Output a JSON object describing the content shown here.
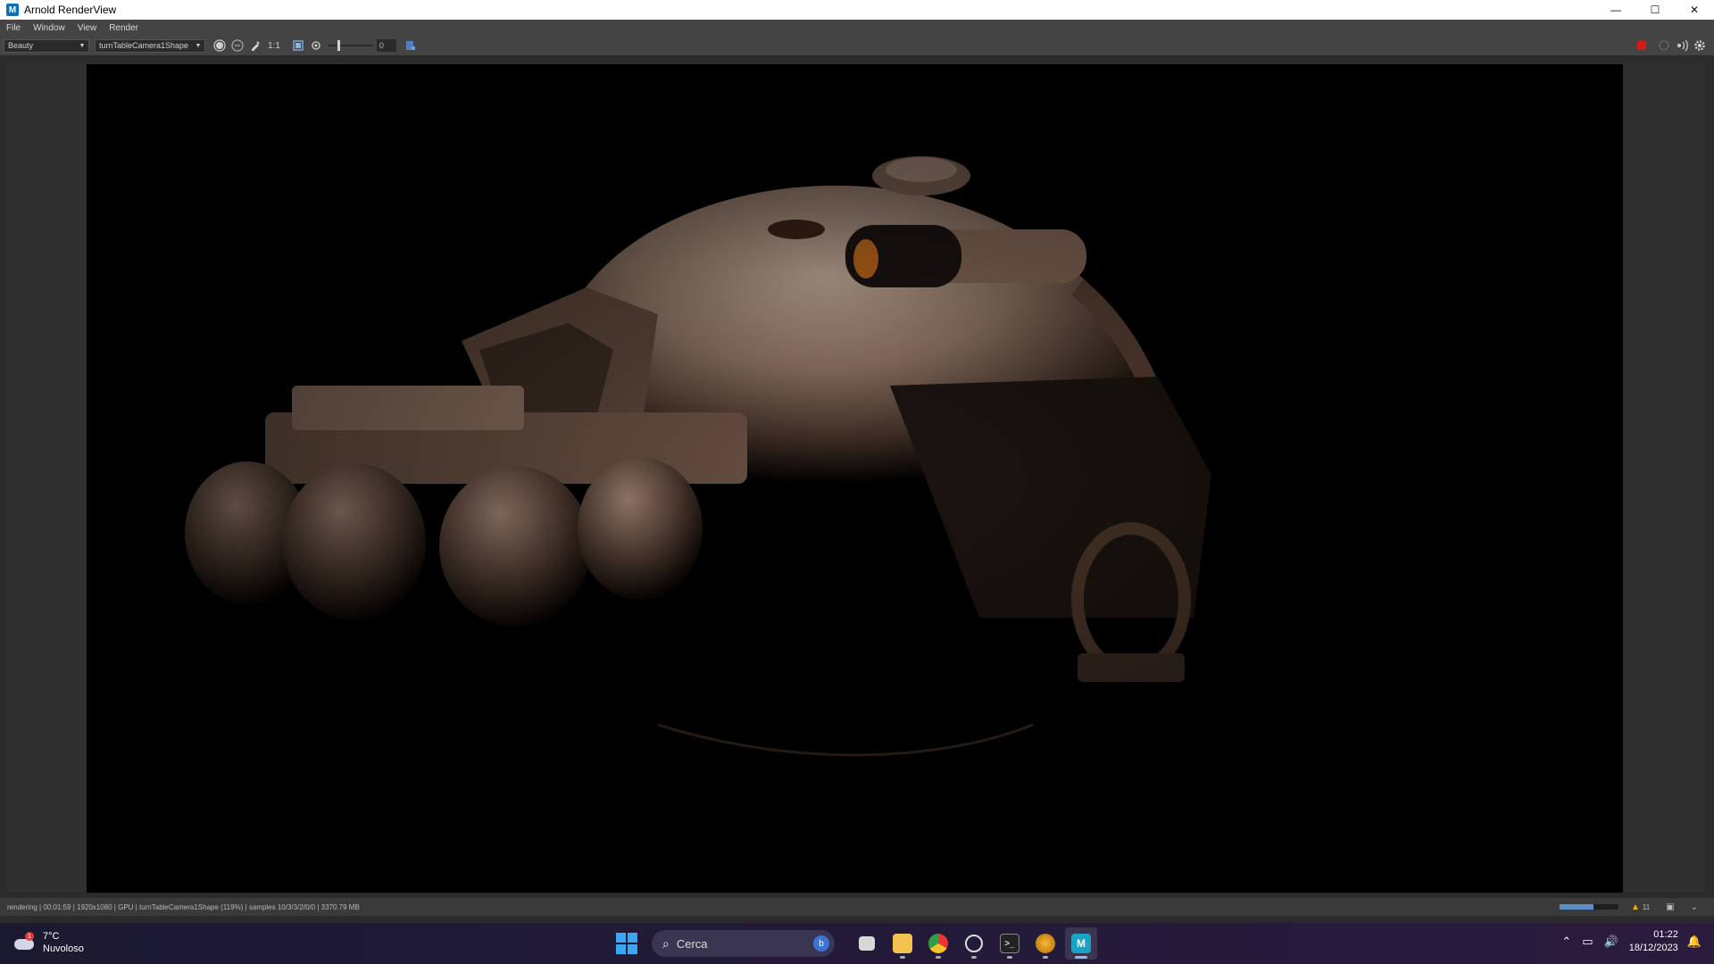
{
  "window": {
    "app_icon": "M",
    "title": "Arnold RenderView",
    "controls": {
      "minimize": "—",
      "maximize": "☐",
      "close": "✕"
    }
  },
  "menu": [
    "File",
    "Window",
    "View",
    "Render"
  ],
  "toolbar": {
    "aov_dropdown": "Beauty",
    "camera_dropdown": "turnTableCamera1Shape",
    "ratio_label": "1:1",
    "exposure_value": "0"
  },
  "render": {
    "description_icon": "render-image"
  },
  "status": {
    "text": "rendering | 00:01:59 | 1920x1080 | GPU | turnTableCamera1Shape (119%) | samples 10/3/3/2/0/0 | 3370.79 MB",
    "progress_label": "58%",
    "progress_fraction": 0.58,
    "warning_count": "11"
  },
  "taskbar": {
    "weather_temp": "7°C",
    "weather_desc": "Nuvoloso",
    "weather_badge": "1",
    "search_placeholder": "Cerca",
    "time": "01:22",
    "date": "18/12/2023"
  },
  "colors": {
    "accent": "#3aa7f2",
    "stop": "#d11a1a",
    "warning": "#e6b800"
  }
}
